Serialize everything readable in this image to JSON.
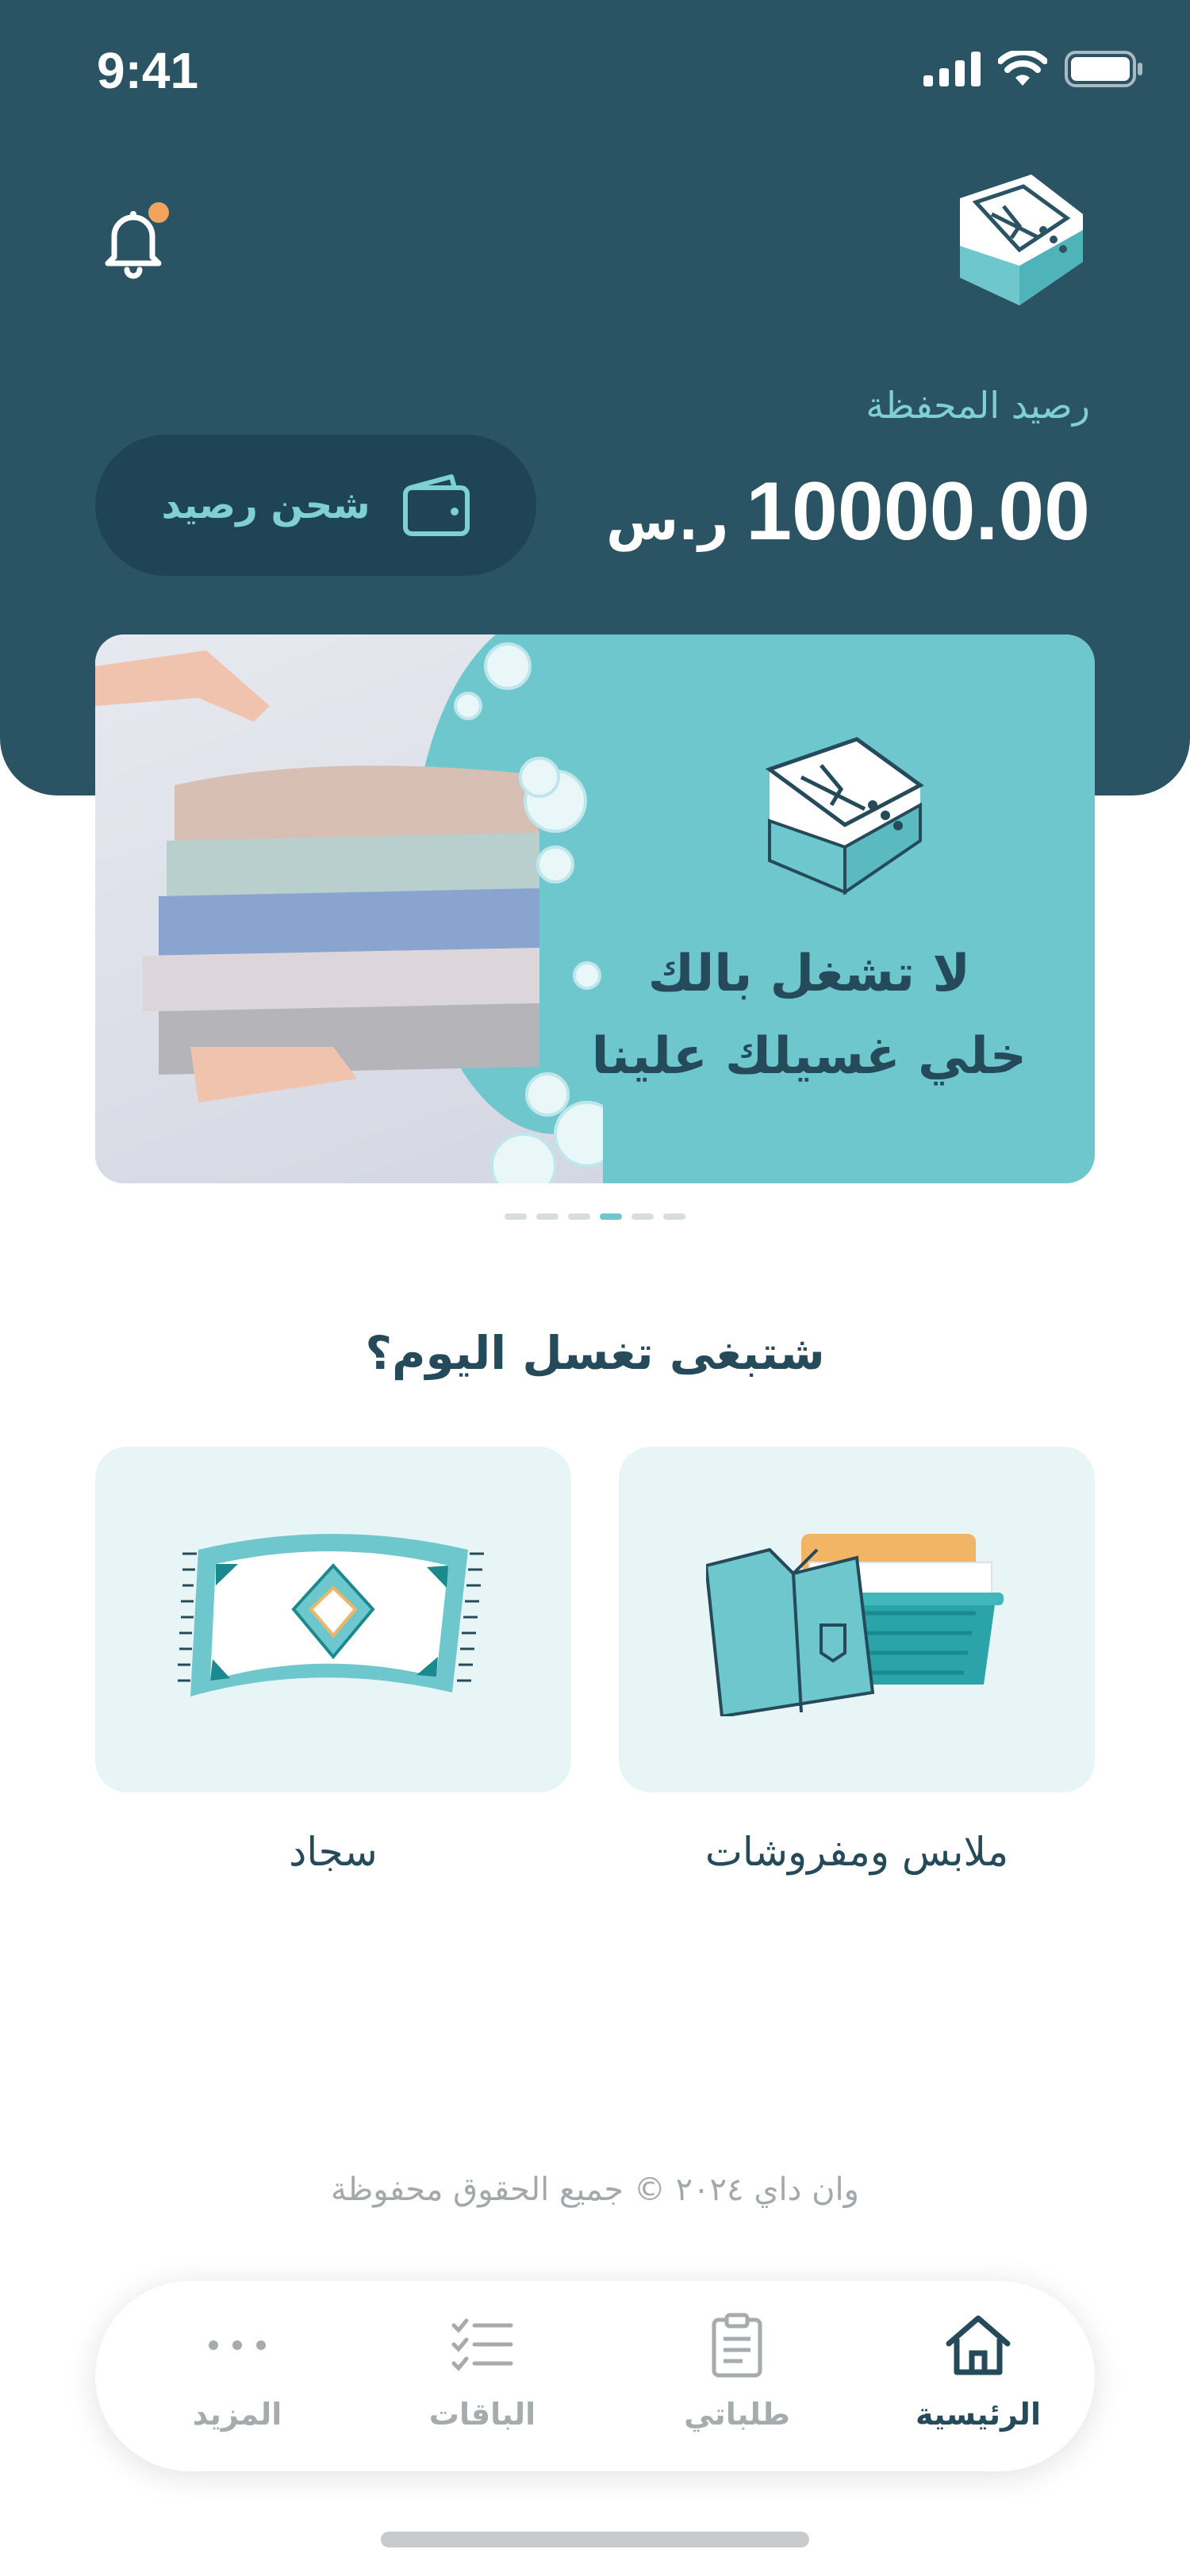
{
  "status_bar": {
    "time": "9:41"
  },
  "header": {
    "wallet_label": "رصيد المحفظة",
    "balance_amount": "10000.00",
    "currency": "ر.س",
    "topup_label": "شحن رصيد"
  },
  "banner": {
    "line1": "لا تشغل بالك",
    "line2": "خلي غسيلك علينا",
    "slides": 6,
    "active_slide": 4
  },
  "services": {
    "title": "شتبغى تغسل اليوم؟",
    "items": [
      {
        "label": "ملابس ومفروشات",
        "icon": "clothes-basket-icon"
      },
      {
        "label": "سجاد",
        "icon": "carpet-icon"
      }
    ]
  },
  "footer": {
    "copyright": "وان داي ٢٠٢٤ © جميع الحقوق محفوظة"
  },
  "tabbar": {
    "items": [
      {
        "label": "الرئيسية",
        "icon": "home-icon",
        "active": true
      },
      {
        "label": "طلباتي",
        "icon": "clipboard-icon",
        "active": false
      },
      {
        "label": "الباقات",
        "icon": "checklist-icon",
        "active": false
      },
      {
        "label": "المزيد",
        "icon": "more-dots-icon",
        "active": false
      }
    ]
  },
  "colors": {
    "header_bg": "#2a5364",
    "accent": "#6ec7cd",
    "text_dark": "#254a5a",
    "notification_dot": "#f2a45c"
  }
}
